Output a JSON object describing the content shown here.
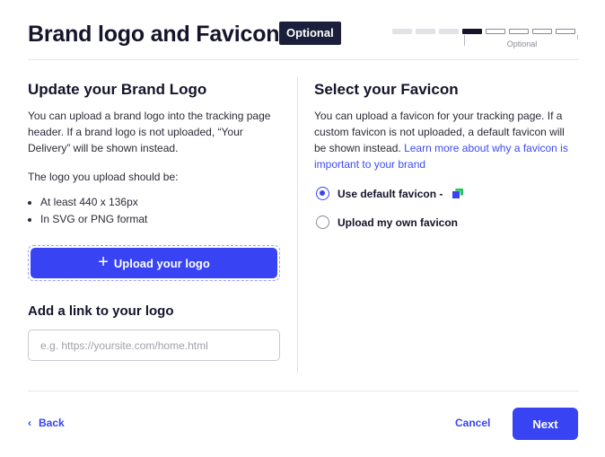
{
  "header": {
    "title": "Brand logo and Favicon",
    "badge": "Optional",
    "progress": {
      "total_steps": 8,
      "current_step": 4,
      "optional_label": "Optional"
    }
  },
  "logo_section": {
    "heading": "Update your Brand Logo",
    "description": "You can upload a brand logo into the tracking page header. If a brand logo is not uploaded, “Your Delivery” will be shown instead.",
    "requirements_intro": "The logo you upload should be:",
    "requirements": [
      "At least 440 x 136px",
      "In SVG or PNG format"
    ],
    "upload_button": "Upload your logo",
    "link_heading": "Add a link to your logo",
    "link_placeholder": "e.g. https://yoursite.com/home.html",
    "link_value": ""
  },
  "favicon_section": {
    "heading": "Select your Favicon",
    "description": "You can upload a favicon for your tracking page. If a custom favicon is not uploaded, a default favicon will be shown instead.",
    "learn_more_link": "Learn more about why a favicon is important to your brand",
    "options": [
      {
        "label": "Use default favicon -",
        "selected": true
      },
      {
        "label": "Upload my own favicon",
        "selected": false
      }
    ]
  },
  "footer": {
    "back_label": "Back",
    "cancel_label": "Cancel",
    "next_label": "Next"
  },
  "colors": {
    "accent": "#3844f4",
    "badge_bg": "#1b1f3b",
    "title": "#14142b"
  }
}
